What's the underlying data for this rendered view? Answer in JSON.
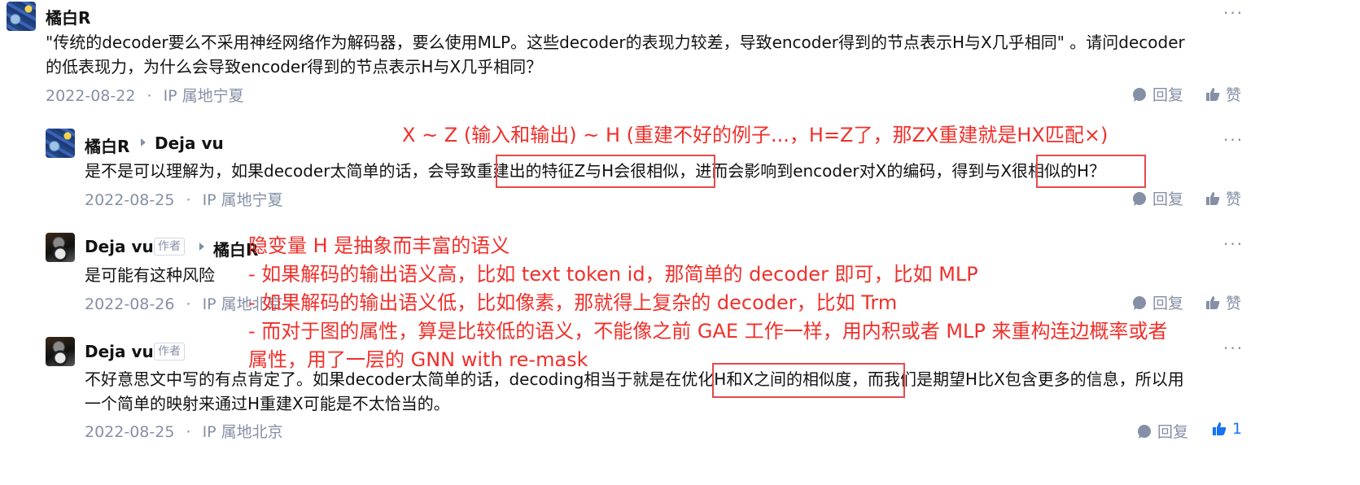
{
  "comments": [
    {
      "author": "橘白R",
      "text_line1": "\"传统的decoder要么不采用神经网络作为解码器，要么使用MLP。这些decoder的表现力较差，导致encoder得到的节点表示H与X几乎相同\" 。请问decoder",
      "text_line2": "的低表现力，为什么会导致encoder得到的节点表示H与X几乎相同？",
      "date": "2022-08-22",
      "location": "IP 属地宁夏",
      "reply_label": "回复",
      "like_label": "赞"
    },
    {
      "author": "橘白R",
      "reply_to": "Deja vu",
      "text": "是不是可以理解为，如果decoder太简单的话，会导致重建出的特征Z与H会很相似，进而会影响到encoder对X的编码，得到与X很相似的H？",
      "date": "2022-08-25",
      "location": "IP 属地宁夏",
      "reply_label": "回复",
      "like_label": "赞"
    },
    {
      "author": "Deja vu",
      "author_tag": "作者",
      "reply_to": "橘白R",
      "text": "是可能有这种风险",
      "date": "2022-08-26",
      "location": "IP 属地北京",
      "reply_label": "回复",
      "like_label": "赞"
    },
    {
      "author": "Deja vu",
      "author_tag": "作者",
      "text_line1": "不好意思文中写的有点肯定了。如果decoder太简单的话，decoding相当于就是在优化H和X之间的相似度，而我们是期望H比X包含更多的信息，所以用",
      "text_line2": "一个简单的映射来通过H重建X可能是不太恰当的。",
      "date": "2022-08-25",
      "location": "IP 属地北京",
      "reply_label": "回复",
      "like_count": "1"
    }
  ],
  "separator": "·",
  "more_glyph": "···",
  "annotations": {
    "top_note": "X ~ Z (输入和输出) ~ H (重建不好的例子...，H=Z了，那ZX重建就是HX匹配×)",
    "note_lines": [
      "隐变量 H 是抽象而丰富的语义",
      "- 如果解码的输出语义高，比如 text token id，那简单的 decoder 即可，比如 MLP",
      "- 如果解码的输出语义低，比如像素，那就得上复杂的 decoder，比如 Trm",
      "- 而对于图的属性，算是比较低的语义，不能像之前 GAE 工作一样，用内积或者 MLP 来重构连边概率或者",
      "属性，用了一层的 GNN with re-mask"
    ],
    "color": "#f0302b"
  },
  "colors": {
    "meta": "#8590a6",
    "accent": "#1772f6",
    "text": "#121212"
  }
}
